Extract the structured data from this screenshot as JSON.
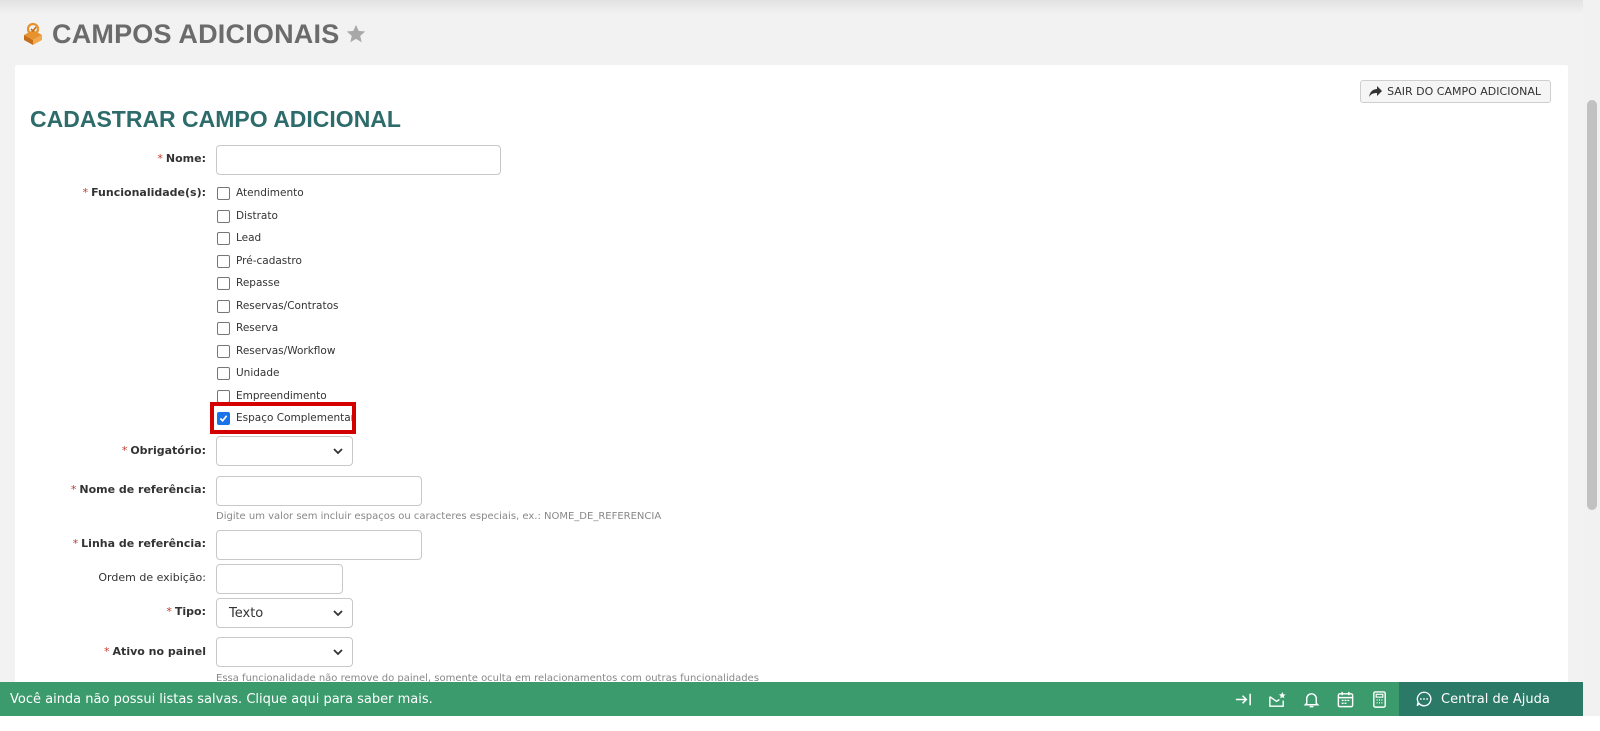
{
  "page": {
    "title": "CAMPOS ADICIONAIS"
  },
  "form": {
    "title": "CADASTRAR CAMPO ADICIONAL",
    "exit_button": "SAIR DO CAMPO ADICIONAL",
    "required_mark": "*",
    "nome": {
      "label": "Nome:",
      "value": ""
    },
    "funcionalidades": {
      "label": "Funcionalidade(s):",
      "options": [
        {
          "label": "Atendimento",
          "checked": false
        },
        {
          "label": "Distrato",
          "checked": false
        },
        {
          "label": "Lead",
          "checked": false
        },
        {
          "label": "Pré-cadastro",
          "checked": false
        },
        {
          "label": "Repasse",
          "checked": false
        },
        {
          "label": "Reservas/Contratos",
          "checked": false
        },
        {
          "label": "Reserva",
          "checked": false
        },
        {
          "label": "Reservas/Workflow",
          "checked": false
        },
        {
          "label": "Unidade",
          "checked": false
        },
        {
          "label": "Empreendimento",
          "checked": false
        },
        {
          "label": "Espaço Complementar",
          "checked": true
        }
      ]
    },
    "obrigatorio": {
      "label": "Obrigatório:",
      "value": ""
    },
    "nome_referencia": {
      "label": "Nome de referência:",
      "value": "",
      "hint": "Digite um valor sem incluir espaços ou caracteres especiais, ex.: NOME_DE_REFERENCIA"
    },
    "linha_referencia": {
      "label": "Linha de referência:",
      "value": ""
    },
    "ordem_exibicao": {
      "label": "Ordem de exibição:",
      "value": ""
    },
    "tipo": {
      "label": "Tipo:",
      "value": "Texto"
    },
    "ativo_painel": {
      "label": "Ativo no painel",
      "value": "",
      "hint": "Essa funcionalidade não remove do painel, somente oculta em relacionamentos com outras funcionalidades"
    }
  },
  "bottom_bar": {
    "message": "Você ainda não possui listas salvas. Clique aqui para saber mais.",
    "help_label": "Central de Ajuda"
  },
  "colors": {
    "title": "#2e6b6b",
    "bottom_bar": "#3b9b6d",
    "help": "#2b7a68",
    "highlight": "#d40000"
  }
}
